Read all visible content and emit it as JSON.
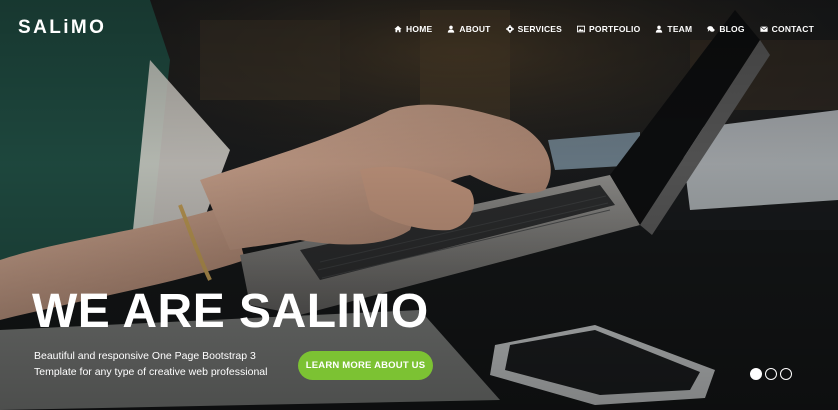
{
  "brand": {
    "name": "SALiMO"
  },
  "nav": {
    "items": [
      {
        "label": "HOME",
        "icon": "home-icon"
      },
      {
        "label": "ABOUT",
        "icon": "user-icon"
      },
      {
        "label": "SERVICES",
        "icon": "gear-icon"
      },
      {
        "label": "PORTFOLIO",
        "icon": "image-icon"
      },
      {
        "label": "TEAM",
        "icon": "user-icon"
      },
      {
        "label": "BLOG",
        "icon": "comments-icon"
      },
      {
        "label": "CONTACT",
        "icon": "envelope-icon"
      }
    ]
  },
  "hero": {
    "headline": "WE ARE SALIMO",
    "subtext": "Beautiful and responsive One Page Bootstrap 3 Template for any type of creative web professional",
    "cta_label": "LEARN MORE ABOUT US",
    "slides_total": 3,
    "slide_active": 1
  },
  "colors": {
    "accent": "#7cc233",
    "text": "#ffffff"
  }
}
